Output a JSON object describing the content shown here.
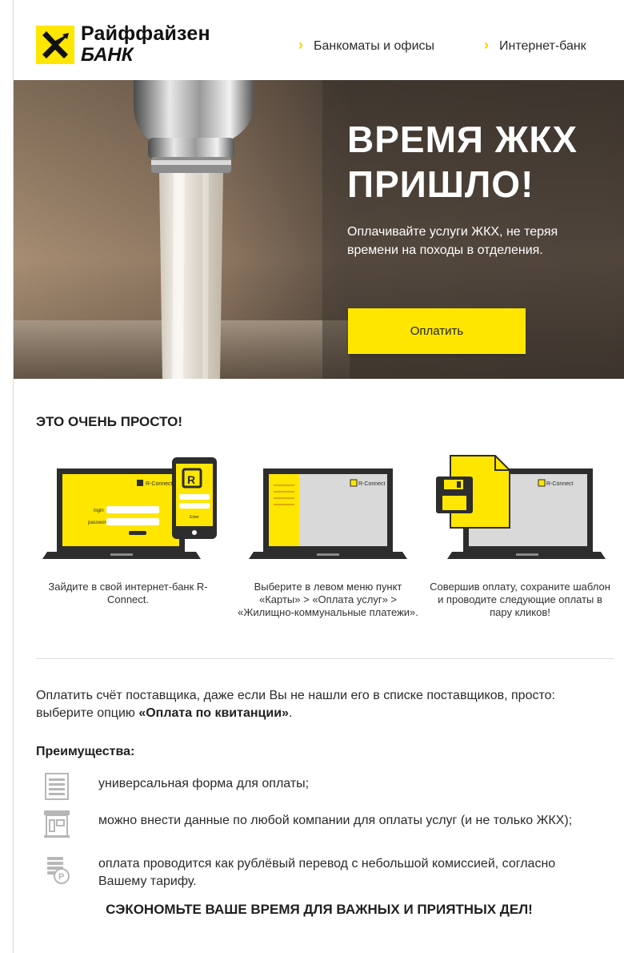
{
  "header": {
    "logo_line1": "Райффайзен",
    "logo_line2": "БАНК",
    "nav": [
      {
        "label": "Банкоматы и офисы"
      },
      {
        "label": "Интернет-банк"
      }
    ]
  },
  "hero": {
    "title_line1": "ВРЕМЯ ЖКХ",
    "title_line2": "ПРИШЛО!",
    "subtitle": "Оплачивайте услуги ЖКХ, не теряя времени на походы в отделения.",
    "button_label": "Оплатить"
  },
  "steps_section": {
    "title": "ЭТО ОЧЕНЬ ПРОСТО!",
    "steps": [
      {
        "text": "Зайдите в свой интернет-банк R-Connect.",
        "screen_labels": [
          "login",
          "password",
          "Enter"
        ]
      },
      {
        "text": "Выберите в левом меню пункт «Карты» > «Оплата услуг» > «Жилищно-коммунальные платежи»."
      },
      {
        "text": "Совершив оплату, сохраните шаблон и проводите следующие оплаты в пару кликов!"
      }
    ],
    "brand_label": "R-Connect"
  },
  "info": {
    "para_before": "Оплатить счёт поставщика, даже если Вы не нашли его в списке поставщиков, просто: выберите опцию ",
    "para_bold": "«Оплата по квитанции»",
    "para_after": "."
  },
  "advantages": {
    "title": "Преимущества:",
    "items": [
      {
        "icon": "form-icon",
        "text": "универсальная форма для оплаты;"
      },
      {
        "icon": "building-icon",
        "text": "можно внести данные по любой компании для оплаты услуг (и не только ЖКХ);"
      },
      {
        "icon": "coins-ruble-icon",
        "text": "оплата проводится как рублёвый перевод с небольшой комиссией, согласно Вашему тарифу."
      }
    ]
  },
  "footer": {
    "cta": "СЭКОНОМЬТЕ ВАШЕ ВРЕМЯ ДЛЯ ВАЖНЫХ И ПРИЯТНЫХ ДЕЛ!"
  },
  "colors": {
    "brand_yellow": "#ffe600",
    "dark": "#2d2d2d"
  }
}
